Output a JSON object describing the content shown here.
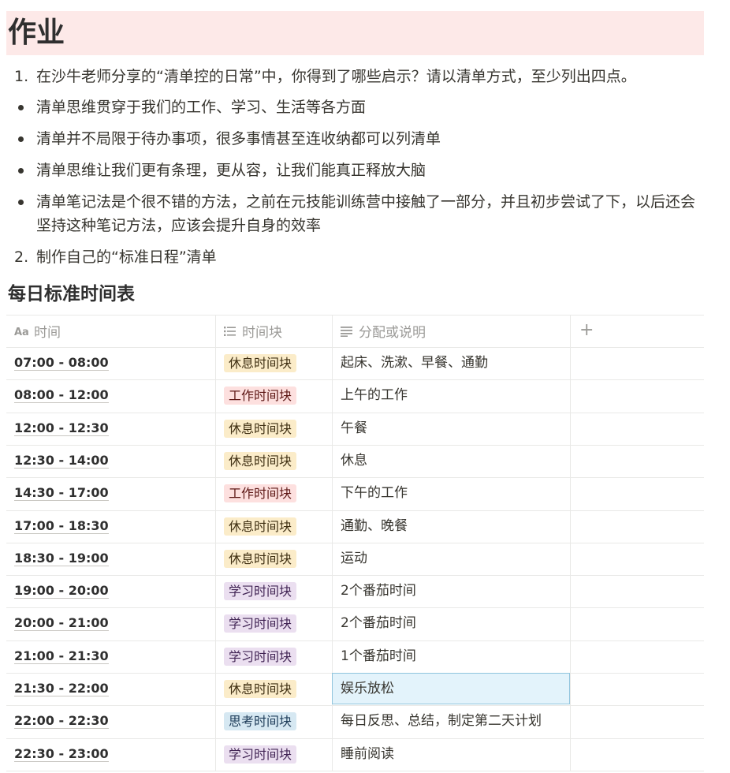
{
  "title": "作业",
  "list_items": [
    {
      "type": "ordered",
      "marker": "1.",
      "text": "在沙牛老师分享的“清单控的日常”中，你得到了哪些启示？请以清单方式，至少列出四点。"
    },
    {
      "type": "bullet",
      "text": "清单思维贯穿于我们的工作、学习、生活等各方面"
    },
    {
      "type": "bullet",
      "text": "清单并不局限于待办事项，很多事情甚至连收纳都可以列清单"
    },
    {
      "type": "bullet",
      "text": "清单思维让我们更有条理，更从容，让我们能真正释放大脑"
    },
    {
      "type": "bullet",
      "text": "清单笔记法是个很不错的方法，之前在元技能训练营中接触了一部分，并且初步尝试了下，以后还会坚持这种笔记方法，应该会提升自身的效率"
    },
    {
      "type": "ordered",
      "marker": "2.",
      "text": "制作自己的“标准日程”清单"
    }
  ],
  "section_heading": "每日标准时间表",
  "table": {
    "columns": [
      {
        "label": "时间",
        "icon": "title-aa-icon"
      },
      {
        "label": "时间块",
        "icon": "list-icon"
      },
      {
        "label": "分配或说明",
        "icon": "text-lines-icon"
      },
      {
        "label": "+",
        "icon": "add-column-icon"
      }
    ],
    "rows": [
      {
        "time": "07:00 - 08:00",
        "block": "休息时间块",
        "kind": "rest",
        "desc": "起床、洗漱、早餐、通勤"
      },
      {
        "time": "08:00 - 12:00",
        "block": "工作时间块",
        "kind": "work",
        "desc": "上午的工作"
      },
      {
        "time": "12:00 - 12:30",
        "block": "休息时间块",
        "kind": "rest",
        "desc": "午餐"
      },
      {
        "time": "12:30 - 14:00",
        "block": "休息时间块",
        "kind": "rest",
        "desc": "休息"
      },
      {
        "time": "14:30 - 17:00",
        "block": "工作时间块",
        "kind": "work",
        "desc": "下午的工作"
      },
      {
        "time": "17:00 - 18:30",
        "block": "休息时间块",
        "kind": "rest",
        "desc": "通勤、晚餐"
      },
      {
        "time": "18:30 - 19:00",
        "block": "休息时间块",
        "kind": "rest",
        "desc": "运动"
      },
      {
        "time": "19:00 - 20:00",
        "block": "学习时间块",
        "kind": "study",
        "desc": "2个番茄时间"
      },
      {
        "time": "20:00 - 21:00",
        "block": "学习时间块",
        "kind": "study",
        "desc": "2个番茄时间"
      },
      {
        "time": "21:00 - 21:30",
        "block": "学习时间块",
        "kind": "study",
        "desc": "1个番茄时间"
      },
      {
        "time": "21:30 - 22:00",
        "block": "休息时间块",
        "kind": "rest",
        "desc": "娱乐放松",
        "selected": true
      },
      {
        "time": "22:00 - 22:30",
        "block": "思考时间块",
        "kind": "think",
        "desc": "每日反思、总结，制定第二天计划"
      },
      {
        "time": "22:30 - 23:00",
        "block": "学习时间块",
        "kind": "study",
        "desc": "睡前阅读"
      }
    ]
  },
  "colors": {
    "title_background": "#fde9e8",
    "rest_tag": "#fbecc9",
    "work_tag": "#fde0df",
    "study_tag": "#ebdff0",
    "think_tag": "#d6e8f2",
    "selected_cell": "#e3f3fb"
  }
}
